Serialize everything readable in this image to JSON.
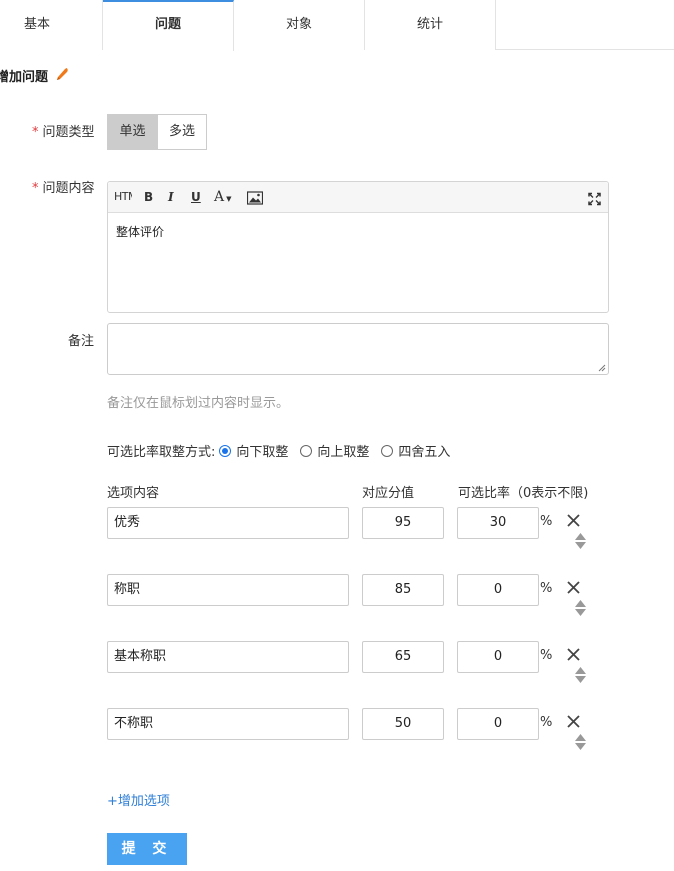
{
  "tabs": [
    {
      "label": "基本"
    },
    {
      "label": "问题"
    },
    {
      "label": "对象"
    },
    {
      "label": "统计"
    }
  ],
  "section_title": "增加问题",
  "form": {
    "type_label": "问题类型",
    "type_options": [
      "单选",
      "多选"
    ],
    "content_label": "问题内容",
    "editor": {
      "toolbar": {
        "html": "HTML",
        "bold": "B",
        "italic": "I",
        "underline": "U",
        "font_color": "A"
      },
      "content": "整体评价"
    },
    "note_label": "备注",
    "note_value": "",
    "note_hint": "备注仅在鼠标划过内容时显示。",
    "rounding": {
      "label": "可选比率取整方式:",
      "options": [
        "向下取整",
        "向上取整",
        "四舍五入"
      ],
      "selected": "向下取整"
    },
    "columns": {
      "option": "选项内容",
      "score": "对应分值",
      "rate": "可选比率（0表示不限)"
    },
    "options": [
      {
        "name": "优秀",
        "score": "95",
        "rate": "30",
        "unit": "%"
      },
      {
        "name": "称职",
        "score": "85",
        "rate": "0",
        "unit": "%"
      },
      {
        "name": "基本称职",
        "score": "65",
        "rate": "0",
        "unit": "%"
      },
      {
        "name": "不称职",
        "score": "50",
        "rate": "0",
        "unit": "%"
      }
    ],
    "add_option": "+增加选项",
    "submit": "提 交"
  },
  "colors": {
    "accent": "#3d8ee0",
    "submit": "#4aa3f0",
    "required": "#e4393c",
    "pen": "#f07a1a"
  }
}
